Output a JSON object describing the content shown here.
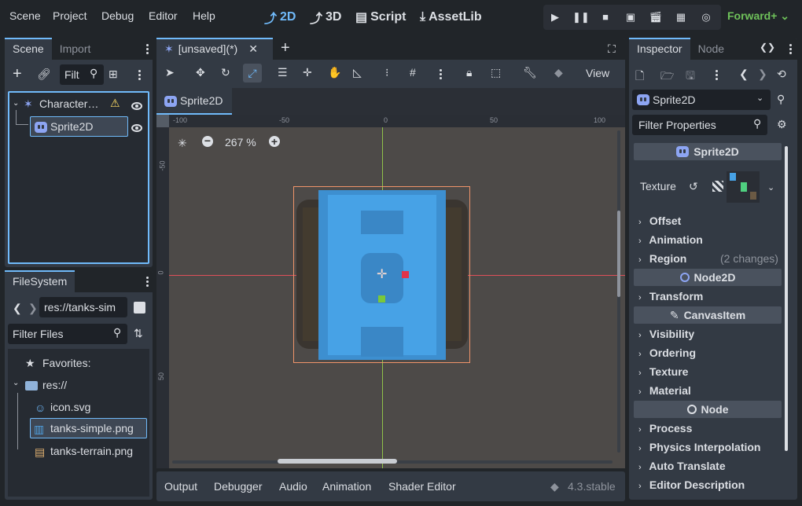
{
  "menu": {
    "items": [
      "Scene",
      "Project",
      "Debug",
      "Editor",
      "Help"
    ]
  },
  "workspaces": [
    {
      "label": "2D",
      "active": true
    },
    {
      "label": "3D",
      "active": false
    },
    {
      "label": "Script",
      "active": false
    },
    {
      "label": "AssetLib",
      "active": false
    }
  ],
  "renderer": "Forward+",
  "scene_dock": {
    "tabs": [
      "Scene",
      "Import"
    ],
    "filter_placeholder": "Filt",
    "root": "Character…",
    "child": "Sprite2D"
  },
  "filesystem": {
    "title": "FileSystem",
    "path": "res://tanks-sim",
    "filter_placeholder": "Filter Files",
    "favorites": "Favorites:",
    "root": "res://",
    "files": [
      "icon.svg",
      "tanks-simple.png",
      "tanks-terrain.png"
    ]
  },
  "editor": {
    "scene_tab": "[unsaved](*)",
    "view_label": "View",
    "node_tab": "Sprite2D",
    "zoom": "267 %",
    "ruler_h": [
      "-100",
      "-50",
      "0",
      "50",
      "100"
    ],
    "ruler_v": [
      "-50",
      "0",
      "50"
    ]
  },
  "bottom": {
    "tabs": [
      "Output",
      "Debugger",
      "Audio",
      "Animation",
      "Shader Editor"
    ],
    "version": "4.3.stable"
  },
  "inspector": {
    "tabs": [
      "Inspector",
      "Node"
    ],
    "node_selector": "Sprite2D",
    "filter_placeholder": "Filter Properties",
    "header": "Sprite2D",
    "texture_label": "Texture",
    "groups": [
      {
        "section": null,
        "props": [
          {
            "name": "Offset",
            "note": ""
          },
          {
            "name": "Animation",
            "note": ""
          },
          {
            "name": "Region",
            "note": "(2 changes)"
          }
        ]
      },
      {
        "section": "Node2D",
        "props": [
          {
            "name": "Transform",
            "note": ""
          }
        ]
      },
      {
        "section": "CanvasItem",
        "props": [
          {
            "name": "Visibility",
            "note": ""
          },
          {
            "name": "Ordering",
            "note": ""
          },
          {
            "name": "Texture",
            "note": ""
          },
          {
            "name": "Material",
            "note": ""
          }
        ]
      },
      {
        "section": "Node",
        "props": [
          {
            "name": "Process",
            "note": ""
          },
          {
            "name": "Physics Interpolation",
            "note": ""
          },
          {
            "name": "Auto Translate",
            "note": ""
          },
          {
            "name": "Editor Description",
            "note": ""
          }
        ]
      }
    ]
  },
  "colors": {
    "accent": "#70bafa",
    "renderer": "#6fc25a",
    "panel": "#333a44",
    "viewport": "#4d4a48",
    "selection": "#f0946a",
    "axis_x": "#e0505a",
    "axis_y": "#8fc24a",
    "warning": "#ffdd65"
  }
}
